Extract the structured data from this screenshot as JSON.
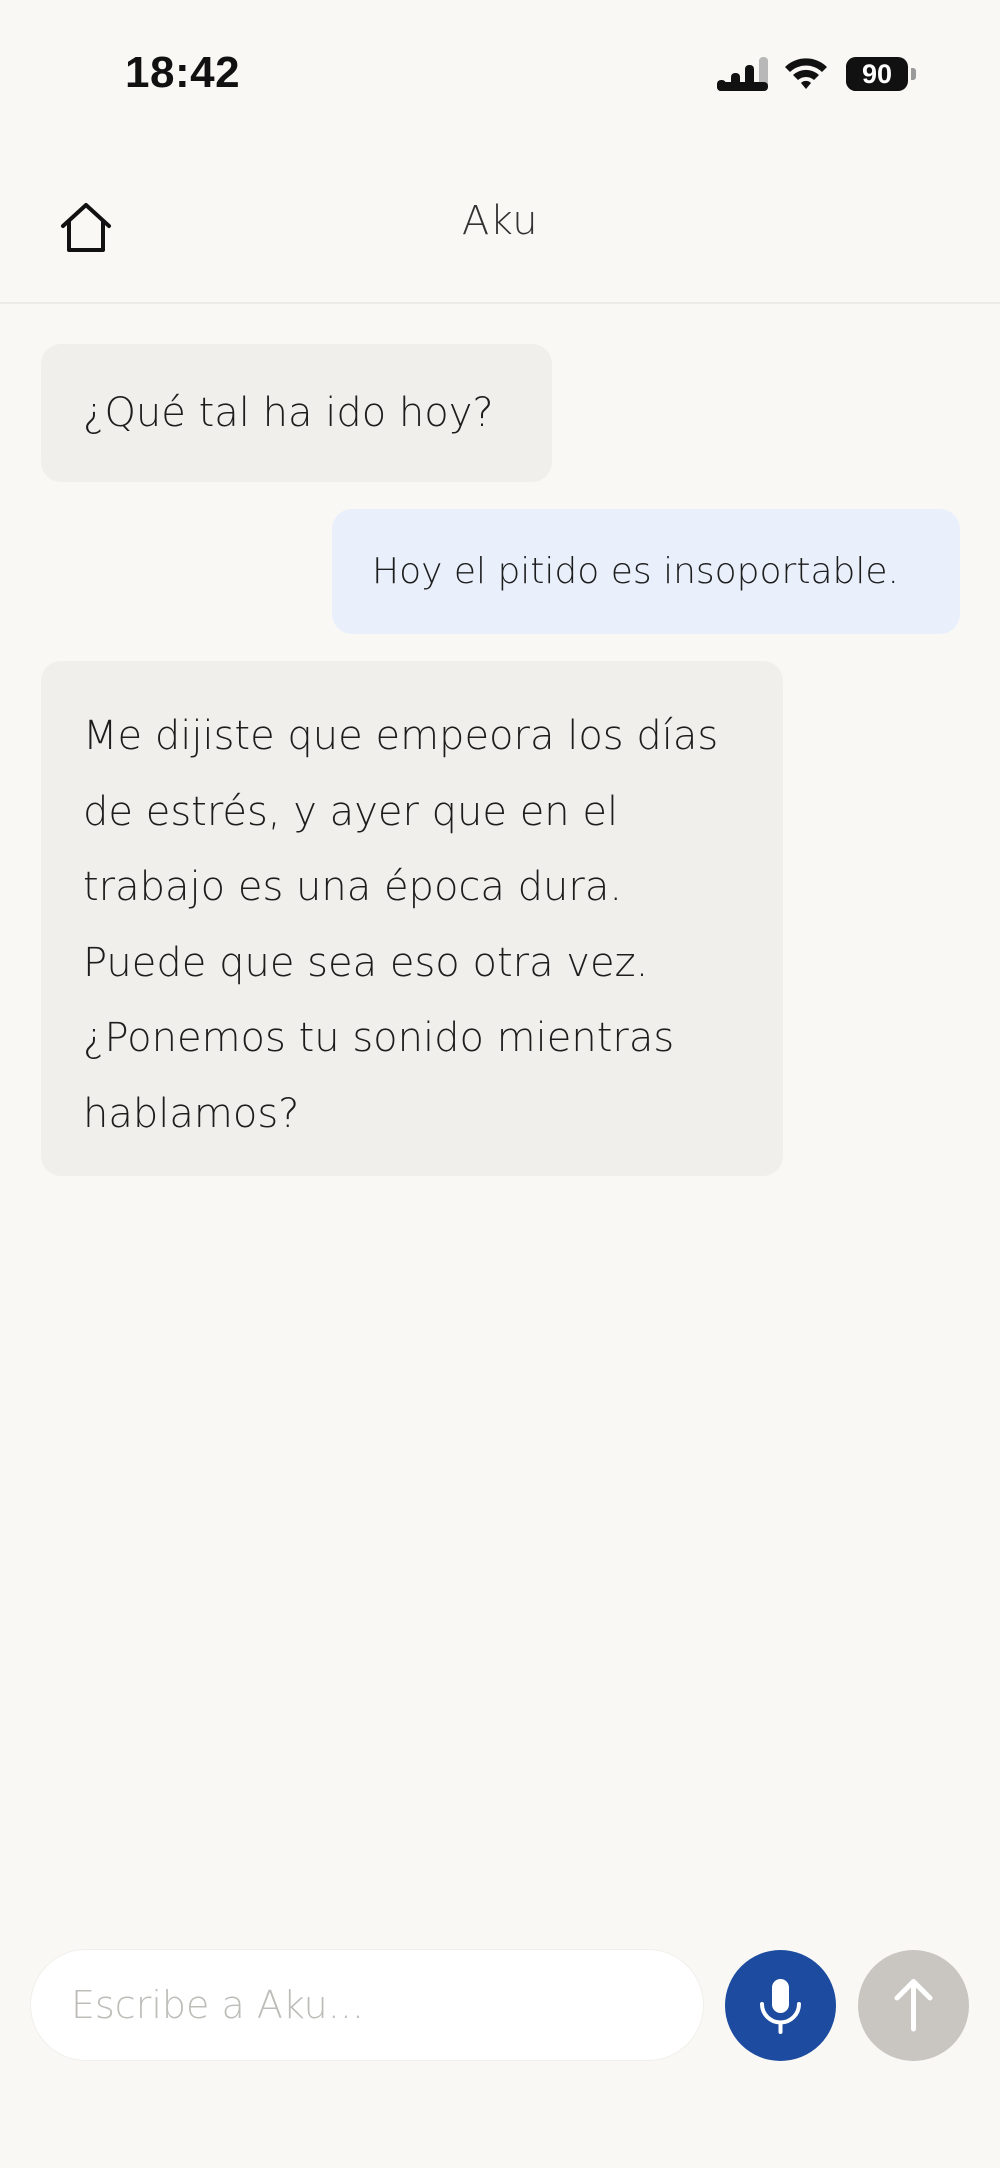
{
  "status_bar": {
    "time": "18:42",
    "battery_percent": "90",
    "battery_level": 0.9,
    "signal_icon": "cellular-signal-icon",
    "wifi_icon": "wifi-icon"
  },
  "header": {
    "title": "Aku",
    "home_icon": "home-icon"
  },
  "messages": [
    {
      "role": "assistant",
      "text": "¿Qué tal ha ido hoy?"
    },
    {
      "role": "user",
      "text": "Hoy el pitido es insoportable."
    },
    {
      "role": "assistant",
      "text": "Me dijiste que empeora los días de estrés, y ayer que en el trabajo es una época dura. Puede que sea eso otra vez. ¿Ponemos tu sonido mientras hablamos?"
    }
  ],
  "composer": {
    "placeholder": "Escribe a Aku...",
    "value": "",
    "mic_icon": "microphone-icon",
    "send_icon": "arrow-up-icon"
  },
  "colors": {
    "background": "#f9f8f5",
    "assistant_bubble": "#f1efeb",
    "user_bubble": "#e9f0fb",
    "mic_button": "#1c4ba0",
    "send_button": "#c9c6c1"
  }
}
